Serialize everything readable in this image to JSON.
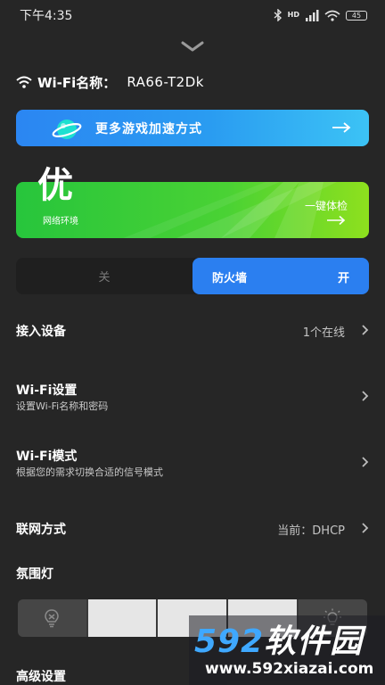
{
  "status_bar": {
    "time": "下午4:35",
    "net_tag": "HD",
    "battery": "45"
  },
  "wifi": {
    "label": "Wi-Fi名称：",
    "name": "RA66-T2Dk"
  },
  "accelerate_banner": {
    "text": "更多游戏加速方式"
  },
  "network_banner": {
    "grade": "优",
    "env_label": "网络环境",
    "check_label": "一键体检"
  },
  "firewall": {
    "off_label": "关",
    "title": "防火墙",
    "state": "开"
  },
  "settings": {
    "devices": {
      "title": "接入设备",
      "value": "1个在线"
    },
    "wifi_settings": {
      "title": "Wi-Fi设置",
      "subtitle": "设置Wi-Fi名称和密码"
    },
    "wifi_mode": {
      "title": "Wi-Fi模式",
      "subtitle": "根据您的需求切换合适的信号模式"
    },
    "connection": {
      "title": "联网方式",
      "value": "当前：DHCP"
    },
    "ambient_light": {
      "title": "氛围灯"
    },
    "next_partial": "高级设置"
  },
  "watermark": {
    "logo_num": "592",
    "logo_cn": "软件园",
    "url": "www.592xiazai.com"
  },
  "colors": {
    "background": "#262626",
    "accent_blue": "#2b7ff0",
    "green": "#27c53c"
  }
}
